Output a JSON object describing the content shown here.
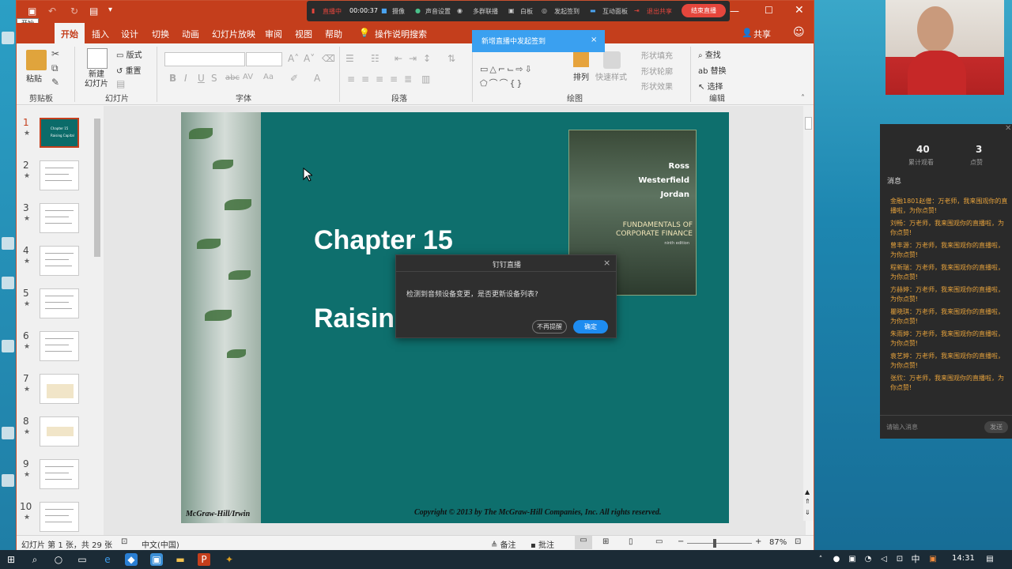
{
  "colors": {
    "ppt_red": "#c43e1c",
    "slide_teal": "#0e6f6d",
    "live_red": "#e5463c",
    "toast_blue": "#3aa0f0",
    "ok_blue": "#1e8cf0"
  },
  "desktop": {
    "labels": [
      "开始",
      "P..."
    ]
  },
  "ppt": {
    "tabs": [
      "开始",
      "插入",
      "设计",
      "切换",
      "动画",
      "幻灯片放映",
      "审阅",
      "视图",
      "帮助"
    ],
    "search_hint": "操作说明搜索",
    "share": "共享",
    "groups": {
      "clipboard": "剪贴板",
      "slides": "幻灯片",
      "font": "字体",
      "paragraph": "段落",
      "drawing": "绘图",
      "editing": "编辑"
    },
    "buttons": {
      "paste": "粘贴",
      "new_slide": "新建\n幻灯片",
      "layout": "版式",
      "reset": "重置",
      "arrange": "排列",
      "quick_styles": "快速样式",
      "shape_fill": "形状填充",
      "shape_outline": "形状轮廓",
      "shape_effects": "形状效果",
      "find": "查找",
      "replace": "替换",
      "select": "选择"
    },
    "thumbnails": [
      {
        "num": "1",
        "star": "★"
      },
      {
        "num": "2",
        "star": "★"
      },
      {
        "num": "3",
        "star": "★"
      },
      {
        "num": "4",
        "star": "★"
      },
      {
        "num": "5",
        "star": "★"
      },
      {
        "num": "6",
        "star": "★"
      },
      {
        "num": "7",
        "star": "★"
      },
      {
        "num": "8",
        "star": "★"
      },
      {
        "num": "9",
        "star": "★"
      },
      {
        "num": "10",
        "star": "★"
      }
    ],
    "thumb1_lines": [
      "Chapter 15",
      "Raising Capital"
    ],
    "slide": {
      "title": "Chapter 15",
      "subtitle": "Raising",
      "book_authors": [
        "Ross",
        "Westerfield",
        "Jordan"
      ],
      "book_title": "FUNDAMENTALS OF CORPORATE FINANCE",
      "book_edition": "ninth edition",
      "footer_left": "McGraw-Hill/Irwin",
      "footer_right": "Copyright © 2013 by The McGraw-Hill Companies, Inc. All rights reserved."
    },
    "status": {
      "slide_info": "幻灯片 第 1 张，共 29 张",
      "language": "中文(中国)",
      "notes": "备注",
      "comments": "批注",
      "zoom": "87%",
      "zoom_minus": "−",
      "zoom_plus": "+"
    }
  },
  "live_toolbar": {
    "status": "直播中",
    "time": "00:00:37",
    "items": [
      "摄像",
      "声音设置",
      "多群联播",
      "白板",
      "发起签到",
      "互动面板",
      "退出共享"
    ],
    "end": "结束直播"
  },
  "toast": {
    "text": "新增直播中发起签到",
    "close": "×"
  },
  "dialog": {
    "title": "钉钉直播",
    "message": "检测到音频设备变更，是否更新设备列表?",
    "cancel": "不再提醒",
    "ok": "确定",
    "close": "×"
  },
  "chat": {
    "viewers": "40",
    "viewers_label": "累计观看",
    "likes": "3",
    "likes_label": "点赞",
    "messages_header": "消息",
    "messages": [
      "金融1801赵僧：万老师，我来围观你的直播啦，为你点赞!",
      "刘畅：万老师，我来围观你的直播啦，为你点赞!",
      "曾丰源：万老师，我来围观你的直播啦，为你点赞!",
      "程新瑞：万老师，我来围观你的直播啦，为你点赞!",
      "方赫婷：万老师，我来围观你的直播啦，为你点赞!",
      "瞿晓琪：万老师，我来围观你的直播啦，为你点赞!",
      "朱雨婷：万老师，我来围观你的直播啦，为你点赞!",
      "袁艺婷：万老师，我来围观你的直播啦，为你点赞!",
      "张欣：万老师，我来围观你的直播啦，为你点赞!"
    ],
    "input_placeholder": "请输入消息",
    "send": "发送"
  },
  "taskbar": {
    "time": "14:31",
    "ime": "中"
  }
}
